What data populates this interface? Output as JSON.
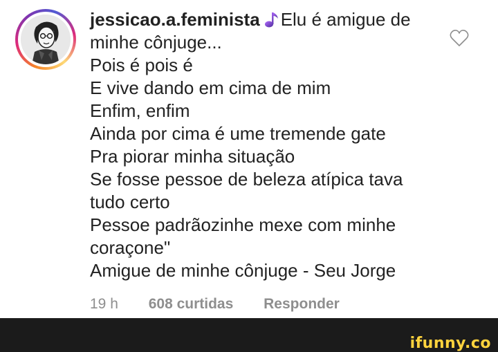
{
  "comment": {
    "username": "jessicao.a.feminista",
    "first_line_text": "Elu é amigue de",
    "lines": [
      "minhe cônjuge...",
      "Pois é pois é",
      "E vive dando em cima de mim",
      "Enfim, enfim",
      "Ainda por cima é ume tremende gate",
      "Pra piorar minha situação",
      "Se fosse pessoe de beleza atípica tava",
      "tudo certo",
      "Pessoe padrãozinhe mexe com minhe",
      "coraçone\"",
      "Amigue de minhe cônjuge - Seu Jorge"
    ],
    "time": "19 h",
    "likes": "608 curtidas",
    "reply": "Responder"
  },
  "icons": {
    "note": "music-note-icon",
    "like": "heart-outline-icon",
    "avatar": "avatar"
  },
  "footer": {
    "watermark": "ifunny.co"
  },
  "colors": {
    "text": "#222222",
    "meta": "#8e8e8e",
    "footer_bg": "#1b1b1b",
    "watermark": "#ffd33d"
  }
}
